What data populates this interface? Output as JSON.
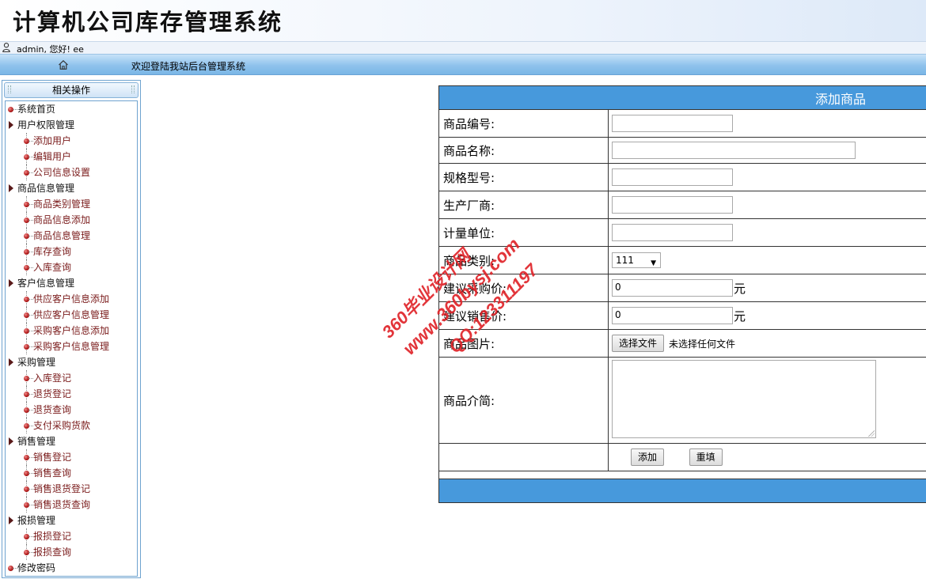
{
  "app": {
    "title": "计算机公司库存管理系统"
  },
  "user": {
    "greeting": "admin, 您好! ee"
  },
  "navbar": {
    "welcome": "欢迎登陆我站后台管理系统"
  },
  "sidebar": {
    "header": "相关操作",
    "items": [
      {
        "label": "系统首页",
        "level": 0,
        "type": "leaf"
      },
      {
        "label": "用户权限管理",
        "level": 0,
        "type": "folder"
      },
      {
        "label": "添加用户",
        "level": 1
      },
      {
        "label": "编辑用户",
        "level": 1
      },
      {
        "label": "公司信息设置",
        "level": 1
      },
      {
        "label": "商品信息管理",
        "level": 0,
        "type": "folder"
      },
      {
        "label": "商品类别管理",
        "level": 1
      },
      {
        "label": "商品信息添加",
        "level": 1
      },
      {
        "label": "商品信息管理",
        "level": 1
      },
      {
        "label": "库存查询",
        "level": 1
      },
      {
        "label": "入库查询",
        "level": 1
      },
      {
        "label": "客户信息管理",
        "level": 0,
        "type": "folder"
      },
      {
        "label": "供应客户信息添加",
        "level": 1
      },
      {
        "label": "供应客户信息管理",
        "level": 1
      },
      {
        "label": "采购客户信息添加",
        "level": 1
      },
      {
        "label": "采购客户信息管理",
        "level": 1
      },
      {
        "label": "采购管理",
        "level": 0,
        "type": "folder"
      },
      {
        "label": "入库登记",
        "level": 1
      },
      {
        "label": "退货登记",
        "level": 1
      },
      {
        "label": "退货查询",
        "level": 1
      },
      {
        "label": "支付采购货款",
        "level": 1
      },
      {
        "label": "销售管理",
        "level": 0,
        "type": "folder"
      },
      {
        "label": "销售登记",
        "level": 1
      },
      {
        "label": "销售查询",
        "level": 1
      },
      {
        "label": "销售退货登记",
        "level": 1
      },
      {
        "label": "销售退货查询",
        "level": 1
      },
      {
        "label": "报损管理",
        "level": 0,
        "type": "folder"
      },
      {
        "label": "报损登记",
        "level": 1
      },
      {
        "label": "报损查询",
        "level": 1
      },
      {
        "label": "修改密码",
        "level": 0,
        "type": "leaf"
      }
    ]
  },
  "form": {
    "title": "添加商品",
    "fields": {
      "code": {
        "label": "商品编号:",
        "value": ""
      },
      "name": {
        "label": "商品名称:",
        "value": ""
      },
      "spec": {
        "label": "规格型号:",
        "value": ""
      },
      "maker": {
        "label": "生产厂商:",
        "value": ""
      },
      "unit": {
        "label": "计量单位:",
        "value": ""
      },
      "category": {
        "label": "商品类别:",
        "selected": "111"
      },
      "buy_price": {
        "label": "建议采购价:",
        "value": "0",
        "suffix": "元"
      },
      "sell_price": {
        "label": "建议销售价:",
        "value": "0",
        "suffix": "元"
      },
      "image": {
        "label": "商品图片:",
        "button": "选择文件",
        "status": "未选择任何文件"
      },
      "intro": {
        "label": "商品介简:",
        "value": ""
      }
    },
    "buttons": {
      "add": "添加",
      "reset": "重填"
    }
  },
  "watermark": {
    "line1": "360毕业设计网",
    "line2": "www.360bysj.com",
    "line3": "QQ:123311197"
  },
  "colors": {
    "header_blue": "#4799dc",
    "nav_blue": "#8fc2ec",
    "tree_text": "#7a1b1b",
    "watermark": "#e0242a"
  }
}
